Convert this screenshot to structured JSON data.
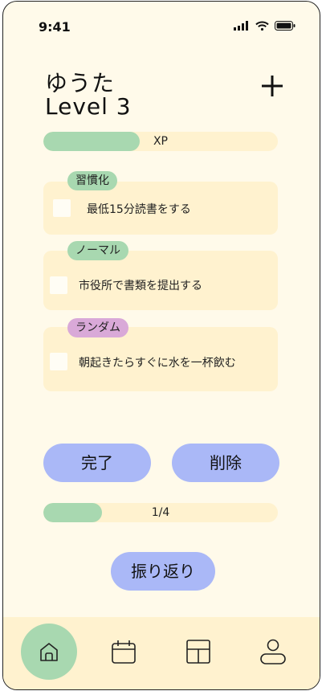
{
  "status_bar": {
    "time": "9:41",
    "icons": [
      "signal-icon",
      "wifi-icon",
      "battery-icon"
    ]
  },
  "profile": {
    "name": "ゆうた",
    "level": "Level 3"
  },
  "add_button": {
    "icon": "plus-icon"
  },
  "xp": {
    "label": "XP",
    "fill_fraction": 0.41
  },
  "tasks": [
    {
      "tag": "習慣化",
      "tag_color": "#a8d8b0",
      "text": "最低15分読書をする",
      "checked": false
    },
    {
      "tag": "ノーマル",
      "tag_color": "#a8d8b0",
      "text": "市役所で書類を提出する",
      "checked": false
    },
    {
      "tag": "ランダム",
      "tag_color": "#d9a9d8",
      "text": "朝起きたらすぐに水を一杯飲む",
      "checked": false
    }
  ],
  "actions": {
    "complete_label": "完了",
    "delete_label": "削除"
  },
  "progress": {
    "label": "1/4",
    "fill_fraction": 0.25
  },
  "review_label": "振り返り",
  "nav": {
    "items": [
      "home-icon",
      "calendar-icon",
      "layout-icon",
      "profile-icon"
    ],
    "active": "home-icon"
  },
  "colors": {
    "background": "#fffaea",
    "card": "#fff2cf",
    "accent_green": "#a8d8b0",
    "accent_blue": "#aab8f7",
    "accent_pink": "#d9a9d8"
  }
}
